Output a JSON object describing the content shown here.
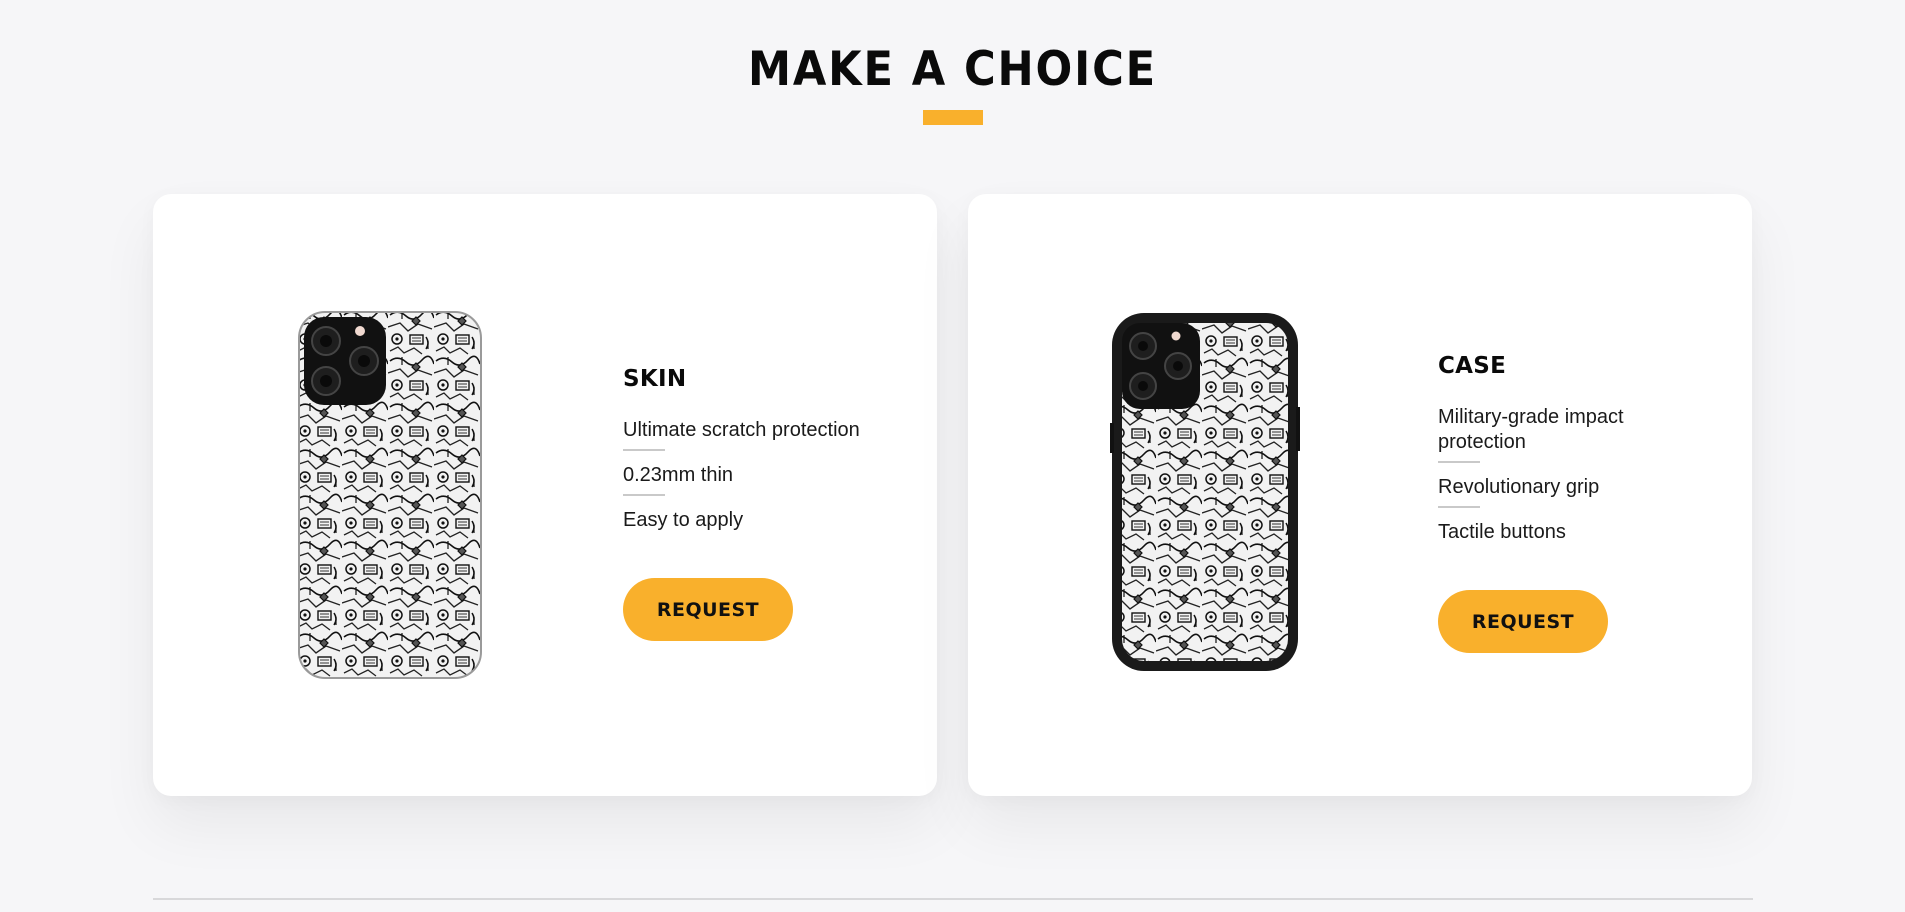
{
  "section": {
    "title": "MAKE A CHOICE",
    "accent_color": "#f9b02c"
  },
  "cards": [
    {
      "title": "SKIN",
      "features": [
        "Ultimate scratch protection",
        "0.23mm thin",
        "Easy to apply"
      ],
      "button_label": "REQUEST",
      "image": "phone-skin-doodle-pattern"
    },
    {
      "title": "CASE",
      "features": [
        "Military-grade impact protection",
        "Revolutionary grip",
        "Tactile buttons"
      ],
      "button_label": "REQUEST",
      "image": "phone-case-doodle-pattern"
    }
  ]
}
